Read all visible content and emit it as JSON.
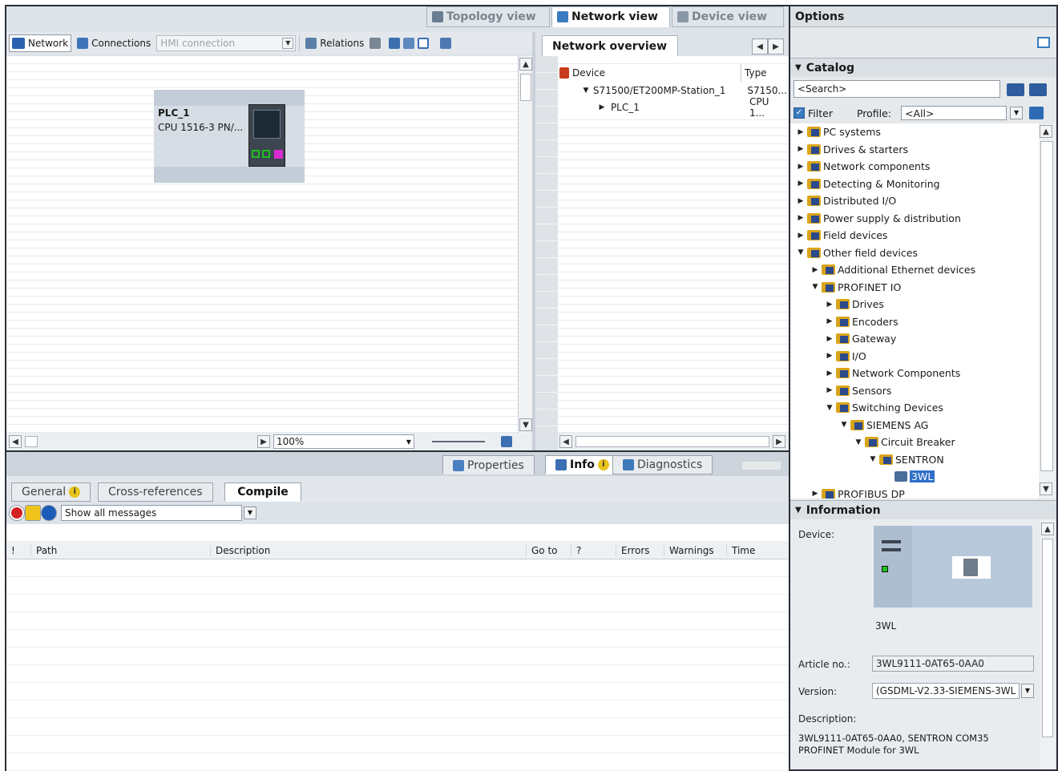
{
  "view_tabs": {
    "topology": "Topology view",
    "network": "Network view",
    "device": "Device view"
  },
  "toolbar": {
    "network": "Network",
    "connections": "Connections",
    "hmi_connection": "HMI connection",
    "relations": "Relations"
  },
  "canvas": {
    "plc_name": "PLC_1",
    "plc_type": "CPU 1516-3 PN/...",
    "zoom": "100%"
  },
  "overview": {
    "title": "Network overview",
    "col_device": "Device",
    "col_type": "Type",
    "rows": [
      {
        "device": "S71500/ET200MP-Station_1",
        "type": "S7150..."
      },
      {
        "device": "PLC_1",
        "type": "CPU 1..."
      }
    ]
  },
  "bottom": {
    "properties": "Properties",
    "info": "Info",
    "diagnostics": "Diagnostics",
    "tabs": {
      "general": "General",
      "crossref": "Cross-references",
      "compile": "Compile"
    },
    "filter_select": "Show all messages",
    "columns": {
      "bang": "!",
      "path": "Path",
      "description": "Description",
      "goto": "Go to",
      "q": "?",
      "errors": "Errors",
      "warnings": "Warnings",
      "time": "Time"
    }
  },
  "right": {
    "options": "Options",
    "catalog": "Catalog",
    "search_placeholder": "<Search>",
    "filter": "Filter",
    "profile_label": "Profile:",
    "profile_value": "<All>",
    "tree": [
      {
        "label": "PC systems"
      },
      {
        "label": "Drives & starters"
      },
      {
        "label": "Network components"
      },
      {
        "label": "Detecting & Monitoring"
      },
      {
        "label": "Distributed I/O"
      },
      {
        "label": "Power supply & distribution"
      },
      {
        "label": "Field devices"
      },
      {
        "label": "Other field devices"
      },
      {
        "label": "Additional Ethernet devices"
      },
      {
        "label": "PROFINET IO"
      },
      {
        "label": "Drives"
      },
      {
        "label": "Encoders"
      },
      {
        "label": "Gateway"
      },
      {
        "label": "I/O"
      },
      {
        "label": "Network Components"
      },
      {
        "label": "Sensors"
      },
      {
        "label": "Switching Devices"
      },
      {
        "label": "SIEMENS AG"
      },
      {
        "label": "Circuit Breaker"
      },
      {
        "label": "SENTRON"
      },
      {
        "label": "3WL"
      },
      {
        "label": "PROFIBUS DP"
      }
    ],
    "information": "Information",
    "device_label": "Device:",
    "device_name": "3WL",
    "article_label": "Article no.:",
    "article_value": "3WL9111-0AT65-0AA0",
    "version_label": "Version:",
    "version_value": "(GSDML-V2.33-SIEMENS-3WL",
    "description_label": "Description:",
    "description_value": "3WL9111-0AT65-0AA0, SENTRON COM35 PROFINET Module for 3WL"
  }
}
